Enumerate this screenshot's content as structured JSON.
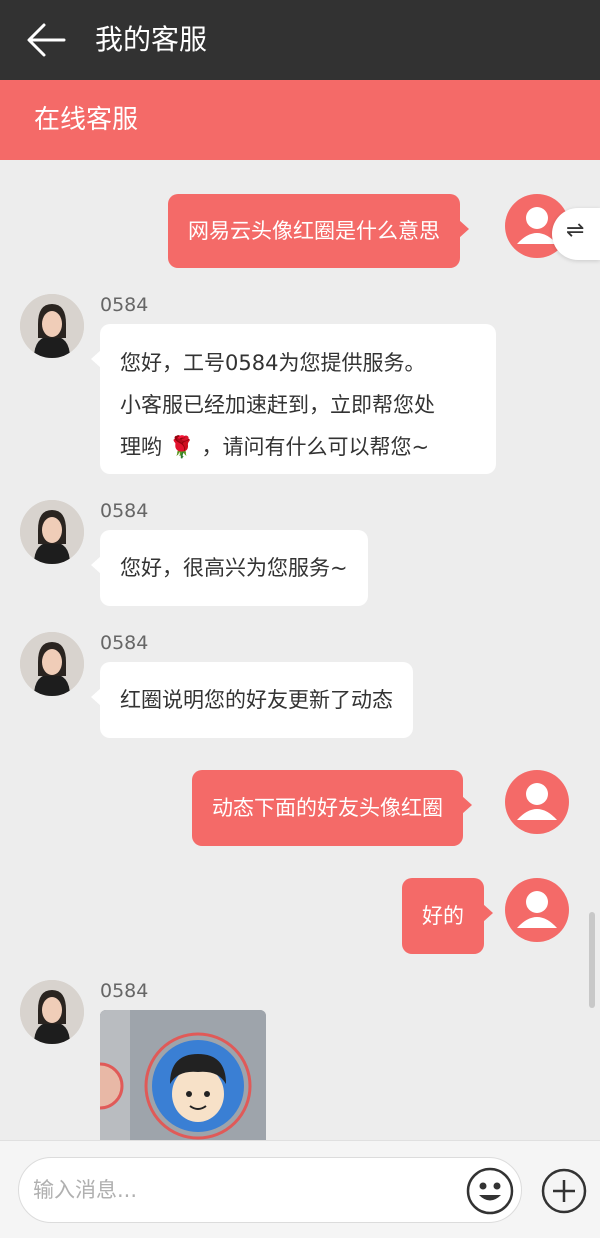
{
  "header": {
    "title": "我的客服",
    "back_icon": "arrow-left-icon"
  },
  "subheader": {
    "title": "在线客服"
  },
  "side_tab": {
    "icon": "swap-arrows-icon",
    "glyph": "⇌"
  },
  "messages": [
    {
      "dir": "out",
      "text": "网易云头像红圈是什么意思"
    },
    {
      "dir": "in",
      "sender": "0584",
      "lines": [
        "您好，工号0584为您提供服务。",
        "小客服已经加速赶到，立即帮您处",
        "理哟 🌹 ，请问有什么可以帮您~"
      ]
    },
    {
      "dir": "in",
      "sender": "0584",
      "text": "您好，很高兴为您服务~"
    },
    {
      "dir": "in",
      "sender": "0584",
      "text": "红圈说明您的好友更新了动态"
    },
    {
      "dir": "out",
      "text": "动态下面的好友头像红圈"
    },
    {
      "dir": "out",
      "text": "好的"
    },
    {
      "dir": "in",
      "sender": "0584",
      "type": "image"
    }
  ],
  "composer": {
    "placeholder": "输入消息...",
    "emoji_icon": "smiley-icon",
    "plus_icon": "plus-circle-icon"
  },
  "colors": {
    "brand": "#f46a68",
    "topbar": "#323232",
    "background": "#ededed"
  }
}
